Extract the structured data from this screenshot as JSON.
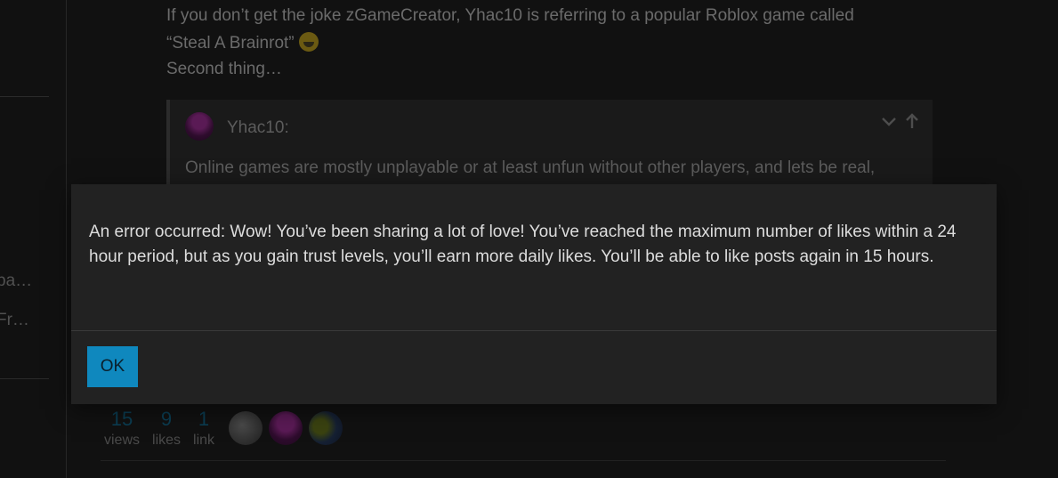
{
  "sidebar": {
    "items": [
      {
        "label": "pa…"
      },
      {
        "label": "Fr…"
      }
    ]
  },
  "post": {
    "lines": [
      "If you don’t get the joke zGameCreator, Yhac10 is referring to a popular Roblox game called",
      "“Steal A Brainrot”",
      "Second thing…"
    ],
    "emoji": "grinning-face-emoji"
  },
  "quote": {
    "author": "Yhac10:",
    "collapse_icon": "chevron-down-icon",
    "goto_icon": "arrow-up-icon",
    "body": "Online games are mostly unplayable or at least unfun without other players, and lets be real,"
  },
  "topic_stats": {
    "views": {
      "number": "15",
      "label": "views"
    },
    "likes": {
      "number": "9",
      "label": "likes"
    },
    "links": {
      "number": "1",
      "label": "link"
    }
  },
  "modal": {
    "message": "An error occurred: Wow! You’ve been sharing a lot of love! You’ve reached the maximum number of likes within a 24 hour period, but as you gain trust levels, you’ll earn more daily likes. You’ll be able to like posts again in 15 hours.",
    "ok_label": "OK",
    "button_color": "#0f88be"
  }
}
